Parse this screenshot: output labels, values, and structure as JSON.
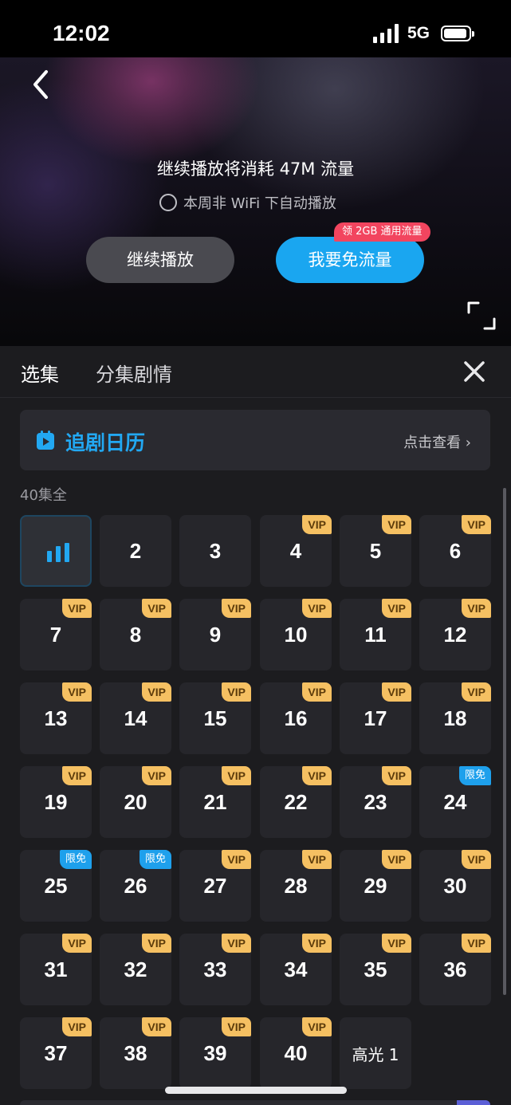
{
  "status_bar": {
    "time": "12:02",
    "network": "5G"
  },
  "player": {
    "notice": "继续播放将消耗 47M 流量",
    "autoplay_label": "本周非 WiFi 下自动播放",
    "continue_label": "继续播放",
    "free_data_label": "我要免流量",
    "promo_badge": "领 2GB 通用流量"
  },
  "tabs": [
    {
      "label": "选集"
    },
    {
      "label": "分集剧情"
    }
  ],
  "calendar": {
    "title": "追剧日历",
    "link": "点击查看 ›"
  },
  "episode_count": "40集全",
  "episodes": [
    {
      "label": "",
      "badge": "",
      "playing": true
    },
    {
      "label": "2",
      "badge": ""
    },
    {
      "label": "3",
      "badge": ""
    },
    {
      "label": "4",
      "badge": "VIP"
    },
    {
      "label": "5",
      "badge": "VIP"
    },
    {
      "label": "6",
      "badge": "VIP"
    },
    {
      "label": "7",
      "badge": "VIP"
    },
    {
      "label": "8",
      "badge": "VIP"
    },
    {
      "label": "9",
      "badge": "VIP"
    },
    {
      "label": "10",
      "badge": "VIP"
    },
    {
      "label": "11",
      "badge": "VIP"
    },
    {
      "label": "12",
      "badge": "VIP"
    },
    {
      "label": "13",
      "badge": "VIP"
    },
    {
      "label": "14",
      "badge": "VIP"
    },
    {
      "label": "15",
      "badge": "VIP"
    },
    {
      "label": "16",
      "badge": "VIP"
    },
    {
      "label": "17",
      "badge": "VIP"
    },
    {
      "label": "18",
      "badge": "VIP"
    },
    {
      "label": "19",
      "badge": "VIP"
    },
    {
      "label": "20",
      "badge": "VIP"
    },
    {
      "label": "21",
      "badge": "VIP"
    },
    {
      "label": "22",
      "badge": "VIP"
    },
    {
      "label": "23",
      "badge": "VIP"
    },
    {
      "label": "24",
      "badge": "限免"
    },
    {
      "label": "25",
      "badge": "限免"
    },
    {
      "label": "26",
      "badge": "限免"
    },
    {
      "label": "27",
      "badge": "VIP"
    },
    {
      "label": "28",
      "badge": "VIP"
    },
    {
      "label": "29",
      "badge": "VIP"
    },
    {
      "label": "30",
      "badge": "VIP"
    },
    {
      "label": "31",
      "badge": "VIP"
    },
    {
      "label": "32",
      "badge": "VIP"
    },
    {
      "label": "33",
      "badge": "VIP"
    },
    {
      "label": "34",
      "badge": "VIP"
    },
    {
      "label": "35",
      "badge": "VIP"
    },
    {
      "label": "36",
      "badge": "VIP"
    },
    {
      "label": "37",
      "badge": "VIP"
    },
    {
      "label": "38",
      "badge": "VIP"
    },
    {
      "label": "39",
      "badge": "VIP"
    },
    {
      "label": "40",
      "badge": "VIP"
    },
    {
      "label": "高光 1",
      "badge": ""
    }
  ],
  "colors": {
    "accent": "#22a8f2",
    "vip_badge": "#f5c062",
    "free_badge": "#1ea0ec",
    "promo": "#f2455f"
  },
  "icons": {
    "back": "chevron-left-icon",
    "fullscreen": "fullscreen-icon",
    "close": "close-icon",
    "calendar": "calendar-play-icon",
    "playing": "playing-bars-icon"
  }
}
